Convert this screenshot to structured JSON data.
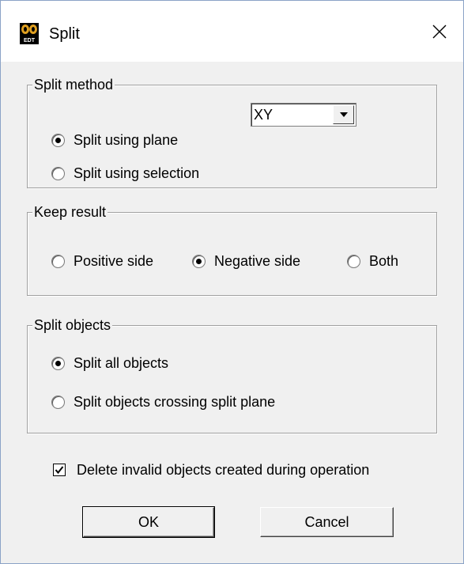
{
  "window": {
    "title": "Split",
    "app_icon_text": "EDT",
    "icons": {
      "app": "edt-app-icon",
      "close": "close-icon"
    }
  },
  "split_method": {
    "label": "Split method",
    "options": [
      {
        "label": "Split using plane",
        "checked": true
      },
      {
        "label": "Split using selection",
        "checked": false
      }
    ],
    "plane_select": {
      "value": "XY",
      "options": [
        "XY"
      ]
    }
  },
  "keep_result": {
    "label": "Keep result",
    "options": [
      {
        "label": "Positive side",
        "checked": false
      },
      {
        "label": "Negative side",
        "checked": true
      },
      {
        "label": "Both",
        "checked": false
      }
    ]
  },
  "split_objects": {
    "label": "Split objects",
    "options": [
      {
        "label": "Split all objects",
        "checked": true
      },
      {
        "label": "Split objects crossing split plane",
        "checked": false
      }
    ]
  },
  "delete_invalid": {
    "label": "Delete invalid objects created during operation",
    "checked": true
  },
  "buttons": {
    "ok": "OK",
    "cancel": "Cancel"
  }
}
